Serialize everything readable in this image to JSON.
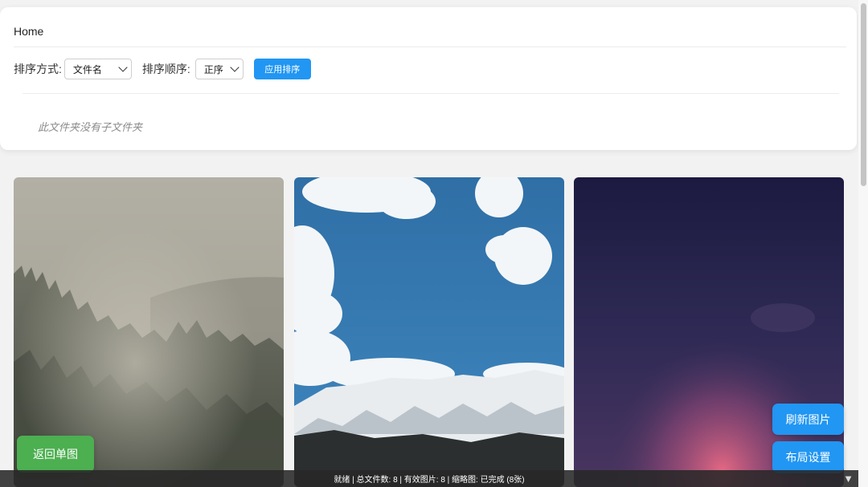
{
  "breadcrumb": "Home",
  "sort": {
    "sort_by_label": "排序方式:",
    "sort_by_value": "文件名",
    "order_label": "排序顺序:",
    "order_value": "正序",
    "apply_label": "应用排序"
  },
  "subfolders": {
    "empty_message": "此文件夹没有子文件夹"
  },
  "gallery": {
    "images": [
      {
        "subject": "foggy forest"
      },
      {
        "subject": "blue sky with snowy mountain"
      },
      {
        "subject": "dusk sky with pink glow"
      }
    ]
  },
  "buttons": {
    "back": "返回单图",
    "refresh": "刷新图片",
    "layout": "布局设置"
  },
  "status": {
    "text": "就绪 | 总文件数: 8 | 有效图片: 8 | 缩略图: 已完成 (8张)",
    "toggle_icon": "▼"
  },
  "colors": {
    "accent": "#2196f3",
    "success": "#4caf50"
  }
}
